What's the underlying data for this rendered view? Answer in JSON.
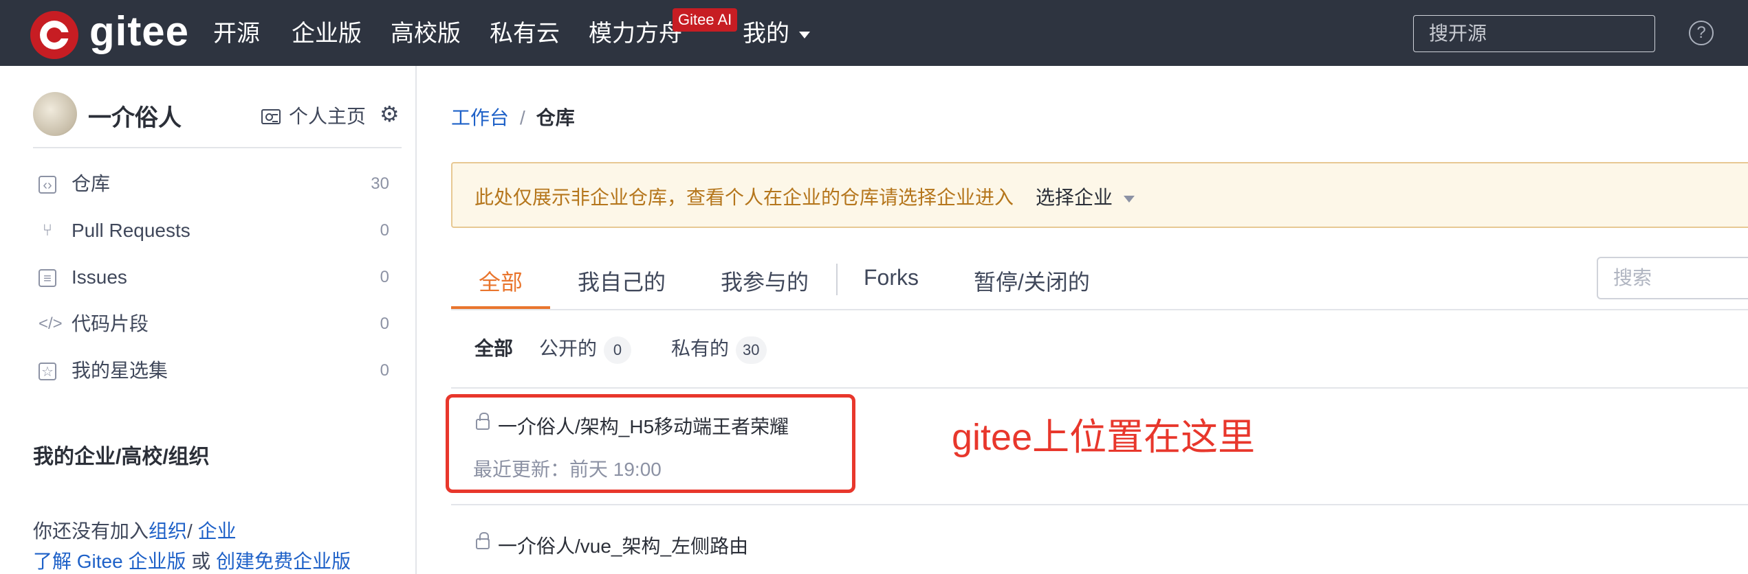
{
  "topnav": {
    "logo_text": "gitee",
    "items": [
      "开源",
      "企业版",
      "高校版",
      "私有云",
      "模力方舟",
      "我的"
    ],
    "ai_badge": "Gitee AI",
    "search_placeholder": "搜开源",
    "help": "?"
  },
  "sidebar": {
    "user_name": "一介俗人",
    "home_label": "个人主页",
    "items": [
      {
        "label": "仓库",
        "count": "30"
      },
      {
        "label": "Pull Requests",
        "count": "0"
      },
      {
        "label": "Issues",
        "count": "0"
      },
      {
        "label": "代码片段",
        "count": "0"
      },
      {
        "label": "我的星选集",
        "count": "0"
      }
    ],
    "org_title": "我的企业/高校/组织",
    "org_text": "你还没有加入",
    "org_link": "组织",
    "org_link2": "企业",
    "learn_link": "了解 Gitee 企业版",
    "or_text": "或",
    "create_link": "创建免费企业版"
  },
  "main": {
    "breadcrumb": {
      "parent": "工作台",
      "sep": "/",
      "current": "仓库"
    },
    "notice": {
      "text": "此处仅展示非企业仓库，查看个人在企业的仓库请选择企业进入",
      "select_label": "选择企业"
    },
    "tabs": [
      "全部",
      "我自己的",
      "我参与的",
      "Forks",
      "暂停/关闭的"
    ],
    "search_placeholder": "搜索",
    "filters": [
      {
        "label": "全部"
      },
      {
        "label": "公开的",
        "count": "0"
      },
      {
        "label": "私有的",
        "count": "30"
      }
    ],
    "repos": [
      {
        "name": "一介俗人/架构_H5移动端王者荣耀",
        "updated": "最近更新：前天 19:00"
      },
      {
        "name": "一介俗人/vue_架构_左侧路由",
        "updated": ""
      }
    ],
    "annotation": "gitee上位置在这里"
  },
  "colors": {
    "accent": "#e9752d",
    "brand": "#c71d23",
    "link": "#1e61c8",
    "annotation": "#e8372c"
  }
}
